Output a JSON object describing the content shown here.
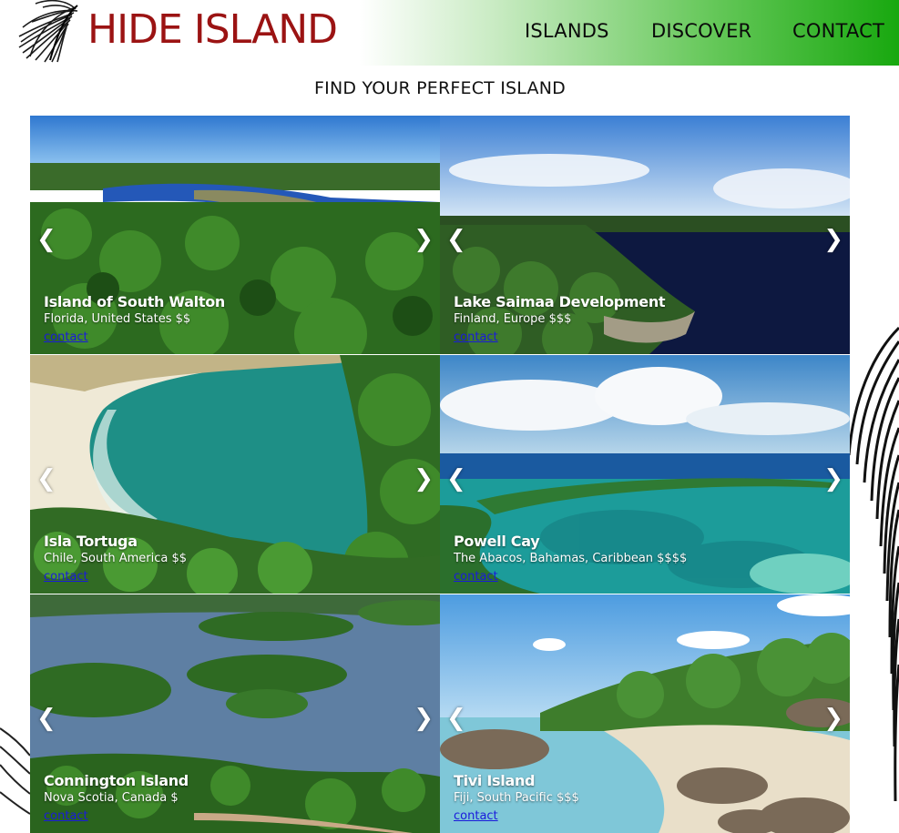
{
  "brand": {
    "name": "HIDE ISLAND",
    "color": "#9b1313"
  },
  "nav": {
    "islands": "ISLANDS",
    "discover": "DISCOVER",
    "contact": "CONTACT"
  },
  "page_title": "FIND YOUR PERFECT ISLAND",
  "arrows": {
    "prev": "❮",
    "next": "❯"
  },
  "islands": [
    {
      "name": "Island of South Walton",
      "location": "Florida, United States $$",
      "link": "contact"
    },
    {
      "name": "Lake Saimaa Development",
      "location": "Finland, Europe $$$",
      "link": "contact"
    },
    {
      "name": "Isla Tortuga",
      "location": "Chile, South America $$",
      "link": "contact"
    },
    {
      "name": "Powell Cay",
      "location": "The Abacos, Bahamas, Caribbean $$$$",
      "link": "contact"
    },
    {
      "name": "Connington Island",
      "location": "Nova Scotia, Canada $",
      "link": "contact"
    },
    {
      "name": "Tivi Island",
      "location": "Fiji, South Pacific $$$",
      "link": "contact"
    }
  ],
  "colors": {
    "accent_green": "#18a80f",
    "link": "#1a1adb"
  }
}
